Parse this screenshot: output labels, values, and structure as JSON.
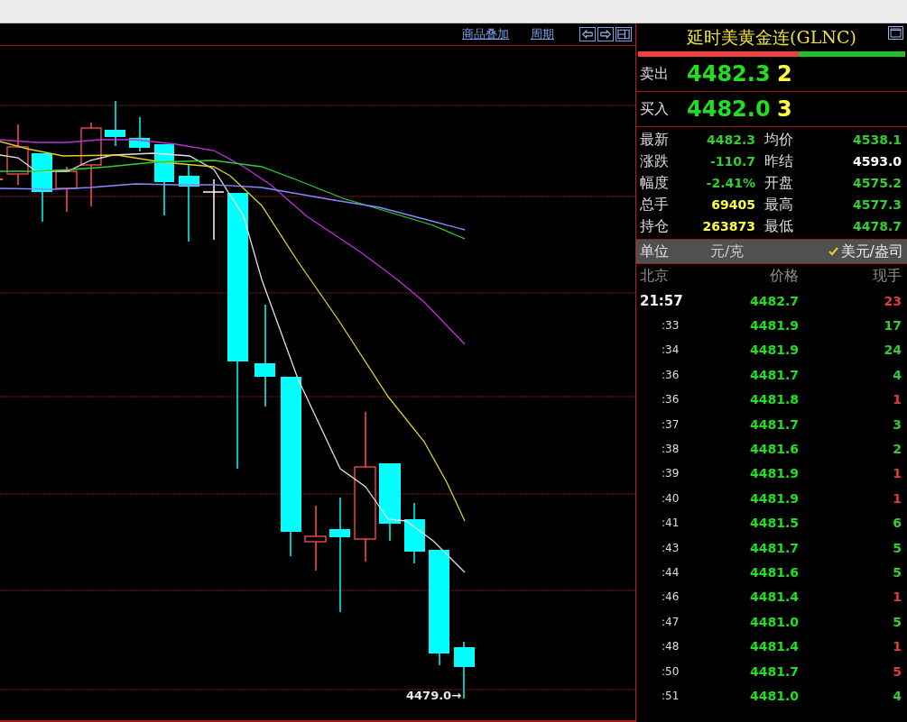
{
  "chart": {
    "links": [
      "商品叠加",
      "周期"
    ],
    "last_price_label": "4479.0→"
  },
  "quote": {
    "title": "延时美黄金连(GLNC)",
    "ratio_bar": {
      "level": 0.6
    },
    "bid_ask": [
      {
        "label": "卖出",
        "price": "4482.3",
        "quantity": "2"
      },
      {
        "label": "买入",
        "price": "4482.0",
        "quantity": "3"
      }
    ],
    "stats": [
      {
        "label": "最新",
        "value": "4482.3",
        "color": "#33cc33"
      },
      {
        "label": "均价",
        "value": "4538.1",
        "color": "#33cc33"
      },
      {
        "label": "涨跌",
        "value": "-110.7",
        "color": "#33cc33"
      },
      {
        "label": "昨结",
        "value": "4593.0",
        "color": "#ffffff"
      },
      {
        "label": "幅度",
        "value": "-2.41%",
        "color": "#33cc33"
      },
      {
        "label": "开盘",
        "value": "4575.2",
        "color": "#33cc33"
      },
      {
        "label": "总手",
        "value": "69405",
        "color": "#ffff40"
      },
      {
        "label": "最高",
        "value": "4577.3",
        "color": "#33cc33"
      },
      {
        "label": "持仓",
        "value": "263873",
        "color": "#ffff40"
      },
      {
        "label": "最低",
        "value": "4478.7",
        "color": "#33cc33"
      }
    ],
    "unit": {
      "label": "单位",
      "options": [
        {
          "label": "元/克",
          "selected": false
        },
        {
          "label": "美元/盎司",
          "selected": true
        }
      ]
    },
    "ticks": {
      "columns": [
        "北京",
        "价格",
        "现手"
      ],
      "rows": [
        {
          "time": "21:57",
          "kind": "hour",
          "price": "4482.7",
          "volume": "23",
          "color": "#e03c3c"
        },
        {
          "time": ":33",
          "kind": "minute",
          "price": "4481.9",
          "volume": "17",
          "color": "#33cc33"
        },
        {
          "time": ":34",
          "kind": "minute",
          "price": "4481.9",
          "volume": "24",
          "color": "#33cc33"
        },
        {
          "time": ":36",
          "kind": "minute",
          "price": "4481.7",
          "volume": "4",
          "color": "#33cc33"
        },
        {
          "time": ":36",
          "kind": "minute",
          "price": "4481.8",
          "volume": "1",
          "color": "#e03c3c"
        },
        {
          "time": ":37",
          "kind": "minute",
          "price": "4481.7",
          "volume": "3",
          "color": "#33cc33"
        },
        {
          "time": ":38",
          "kind": "minute",
          "price": "4481.6",
          "volume": "2",
          "color": "#33cc33"
        },
        {
          "time": ":39",
          "kind": "minute",
          "price": "4481.9",
          "volume": "1",
          "color": "#e03c3c"
        },
        {
          "time": ":40",
          "kind": "minute",
          "price": "4481.9",
          "volume": "1",
          "color": "#e03c3c"
        },
        {
          "time": ":41",
          "kind": "minute",
          "price": "4481.5",
          "volume": "6",
          "color": "#33cc33"
        },
        {
          "time": ":43",
          "kind": "minute",
          "price": "4481.7",
          "volume": "5",
          "color": "#33cc33"
        },
        {
          "time": ":44",
          "kind": "minute",
          "price": "4481.6",
          "volume": "5",
          "color": "#33cc33"
        },
        {
          "time": ":46",
          "kind": "minute",
          "price": "4481.4",
          "volume": "1",
          "color": "#e03c3c"
        },
        {
          "time": ":47",
          "kind": "minute",
          "price": "4481.0",
          "volume": "5",
          "color": "#33cc33"
        },
        {
          "time": ":48",
          "kind": "minute",
          "price": "4481.4",
          "volume": "1",
          "color": "#e03c3c"
        },
        {
          "time": ":50",
          "kind": "minute",
          "price": "4481.7",
          "volume": "5",
          "color": "#e03c3c"
        },
        {
          "time": ":51",
          "kind": "minute",
          "price": "4481.0",
          "volume": "4",
          "color": "#33cc33"
        }
      ]
    }
  }
}
